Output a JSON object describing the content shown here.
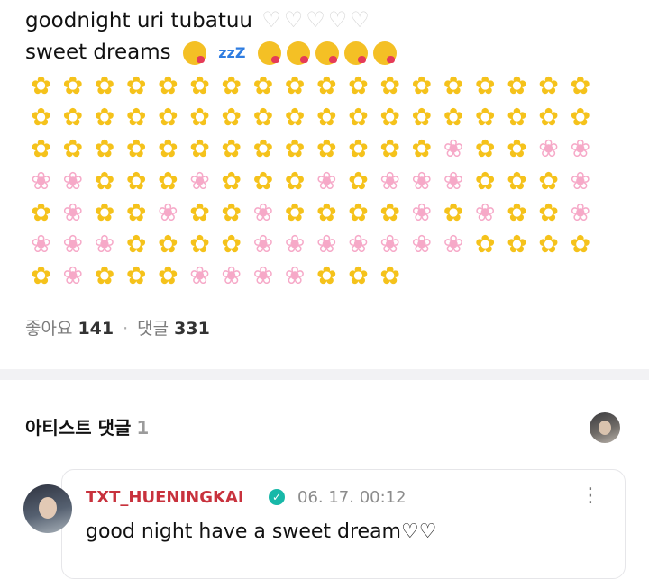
{
  "post": {
    "line1_text": "goodnight uri tubatuu",
    "line1_hearts": [
      "🤍",
      "🤍",
      "🤍",
      "🤍",
      "🤍"
    ],
    "line2_text": "sweet dreams",
    "line2_zzz": "zzZ",
    "kiss_count_before_zzz": 1,
    "kiss_count_after_zzz": 5
  },
  "flowers": {
    "rows": [
      [
        "y",
        "y",
        "y",
        "y",
        "y",
        "y",
        "y",
        "y",
        "y",
        "y",
        "y",
        "y",
        "y",
        "y",
        "y",
        "y",
        "y",
        "y"
      ],
      [
        "y",
        "y",
        "y",
        "y",
        "y",
        "y",
        "y",
        "y",
        "y",
        "y",
        "y",
        "y",
        "y",
        "y",
        "y",
        "y",
        "y",
        "y"
      ],
      [
        "y",
        "y",
        "y",
        "y",
        "y",
        "y",
        "y",
        "y",
        "y",
        "y",
        "y",
        "y",
        "y",
        "p",
        "y",
        "y",
        "p",
        "p"
      ],
      [
        "p",
        "p",
        "y",
        "y",
        "y",
        "p",
        "y",
        "y",
        "y",
        "p",
        "y",
        "p",
        "p",
        "p",
        "y",
        "y",
        "y",
        "p"
      ],
      [
        "y",
        "p",
        "y",
        "y",
        "p",
        "y",
        "y",
        "p",
        "y",
        "y",
        "y",
        "y",
        "p",
        "y",
        "p",
        "y",
        "y",
        "p"
      ],
      [
        "p",
        "p",
        "p",
        "y",
        "y",
        "y",
        "y",
        "p",
        "p",
        "p",
        "p",
        "p",
        "p",
        "p",
        "y",
        "y",
        "y",
        "y"
      ],
      [
        "y",
        "p",
        "y",
        "y",
        "y",
        "p",
        "p",
        "p",
        "p",
        "y",
        "y",
        "y"
      ]
    ],
    "yellow_glyph": "✿",
    "pink_glyph": "❀",
    "colors": {
      "yellow": "#f5c21b",
      "pink": "#f6a9c8"
    }
  },
  "stats": {
    "likes_label": "좋아요",
    "likes_count": "141",
    "separator": "·",
    "comments_label": "댓글",
    "comments_count": "331"
  },
  "artist_comments": {
    "title": "아티스트 댓글",
    "count": "1"
  },
  "comment": {
    "author": "TXT_HUENINGKAI",
    "verified_glyph": "✓",
    "time": "06. 17. 00:12",
    "text": "good night have a sweet dream♡♡",
    "more_glyph": "⋮"
  },
  "colors": {
    "author": "#c8323d",
    "verified": "#18b8a8",
    "muted": "#8c8c8c",
    "divider": "#f2f2f4"
  }
}
